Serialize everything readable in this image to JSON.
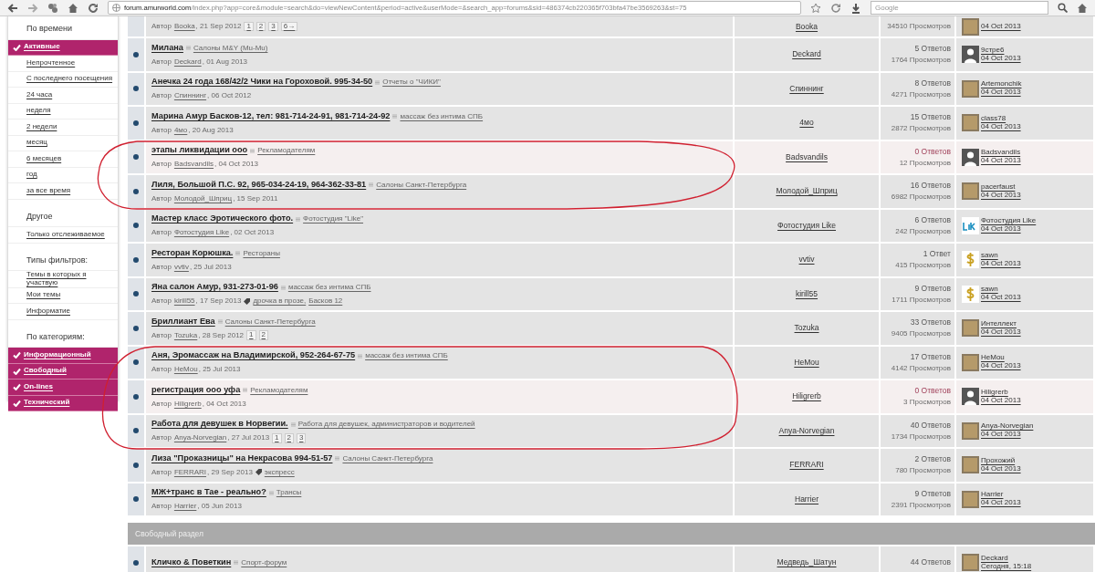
{
  "browser": {
    "url": "forum.amurworld.com/index.php?app=core&module=search&do=viewNewContent&period=active&userMode=&search_app=forums&sid=486374cb220365f703bfa47be3569263&st=75",
    "search_placeholder": "Google"
  },
  "sidebar": [
    {
      "heading": "По времени",
      "items": [
        {
          "label": "Активные",
          "selected": true
        },
        {
          "label": "Непрочтенное",
          "selected": false
        },
        {
          "label": "С последнего посещения",
          "selected": false
        },
        {
          "label": "24 часа",
          "selected": false
        },
        {
          "label": "неделя",
          "selected": false
        },
        {
          "label": "2 недели",
          "selected": false
        },
        {
          "label": "месяц",
          "selected": false
        },
        {
          "label": "6 месяцев",
          "selected": false
        },
        {
          "label": "год",
          "selected": false
        },
        {
          "label": "за все время",
          "selected": false
        }
      ]
    },
    {
      "heading": "Другое",
      "items": [
        {
          "label": "Только отслеживаемое",
          "selected": false
        }
      ]
    },
    {
      "heading": "Типы фильтров:",
      "items": [
        {
          "label": "Темы в которых я участвую",
          "selected": false
        },
        {
          "label": "Мои темы",
          "selected": false
        },
        {
          "label": "Информатие",
          "selected": false
        }
      ]
    },
    {
      "heading": "По категориям:",
      "items": [
        {
          "label": "Информационный",
          "selected": true
        },
        {
          "label": "Свободный",
          "selected": true
        },
        {
          "label": "On-lines",
          "selected": true
        },
        {
          "label": "Технический",
          "selected": true
        }
      ]
    }
  ],
  "topics": [
    {
      "by": "Автор",
      "author": "Booka",
      "date": ", 21 Sep 2012",
      "pages": [
        "1",
        "2",
        "3",
        "6→"
      ],
      "starter": "Booka",
      "views": "34510 Просмотров",
      "last_date": "04 Oct 2013",
      "avatar": {
        "kind": "photo"
      },
      "highlighted": false
    },
    {
      "title": "Милана",
      "forum": "Салоны M&Y (Mu-Mu)",
      "by": "Автор",
      "author": "Deckard",
      "date": ", 01 Aug 2013",
      "starter": "Deckard",
      "replies": "5 Ответов",
      "views": "1764 Просмотров",
      "last_poster": "9стре6",
      "last_date": "04 Oct 2013",
      "avatar": {
        "kind": "silhouette"
      },
      "highlighted": false
    },
    {
      "title": "Анечка 24 года 168/42/2 Чики на Гороховой. 995-34-50",
      "forum": "Отчеты о \"ЧИКИ\"",
      "by": "Автор",
      "author": "Спиннинг",
      "date": ", 06 Oct 2012",
      "starter": "Спиннинг",
      "replies": "8 Ответов",
      "views": "4271 Просмотров",
      "last_poster": "Artemonchik",
      "last_date": "04 Oct 2013",
      "avatar": {
        "kind": "photo"
      },
      "highlighted": false
    },
    {
      "title": "Марина Амур Басков-12, тел: 981-714-24-91, 981-714-24-92",
      "forum": "массаж без интима СПБ",
      "by": "Автор",
      "author": "4мо",
      "date": ", 20 Aug 2013",
      "starter": "4мо",
      "replies": "15 Ответов",
      "views": "2872 Просмотров",
      "last_poster": "class78",
      "last_date": "04 Oct 2013",
      "avatar": {
        "kind": "photo"
      },
      "highlighted": false
    },
    {
      "title": "этапы ликвидации ооо",
      "forum": "Рекламодателям",
      "by": "Автор",
      "author": "Badsvandils",
      "date": ", 04 Oct 2013",
      "starter": "Badsvandils",
      "replies": "0 Ответов",
      "views": "12 Просмотров",
      "last_poster": "Badsvandils",
      "last_date": "04 Oct 2013",
      "avatar": {
        "kind": "silhouette"
      },
      "highlighted": true
    },
    {
      "title": "Лиля, Большой П.С. 92, 965-034-24-19, 964-362-33-81",
      "forum": "Салоны Санкт-Петербурга",
      "by": "Автор",
      "author": "Молодой_Шприц",
      "date": ", 15 Sep 2011",
      "starter": "Молодой_Шприц",
      "replies": "16 Ответов",
      "views": "6982 Просмотров",
      "last_poster": "pacerfaust",
      "last_date": "04 Oct 2013",
      "avatar": {
        "kind": "photo"
      },
      "highlighted": false
    },
    {
      "title": "Мастер класс Эротического фото.",
      "forum": "Фотостудия \"Like\"",
      "by": "Автор",
      "author": "Фотостудия Like",
      "date": ", 02 Oct 2013",
      "starter": "Фотостудия Like",
      "replies": "6 Ответов",
      "views": "242 Просмотров",
      "last_poster": "Фотостудия Like",
      "last_date": "04 Oct 2013",
      "avatar": {
        "kind": "logo"
      },
      "highlighted": false
    },
    {
      "title": "Ресторан Корюшка.",
      "forum": "Рестораны",
      "by": "Автор",
      "author": "vvtiv",
      "date": ", 25 Jul 2013",
      "starter": "vvtiv",
      "replies": "1 Ответ",
      "views": "415 Просмотров",
      "last_poster": "sawn",
      "last_date": "04 Oct 2013",
      "avatar": {
        "kind": "dollar"
      },
      "highlighted": false
    },
    {
      "title": "Яна салон Амур, 931-273-01-96",
      "forum": "массаж без интима СПБ",
      "by": "Автор",
      "author": "kirill55",
      "date": ", 17 Sep 2013",
      "tags": [
        "дрочка в прозе,",
        "Басков 12"
      ],
      "starter": "kirill55",
      "replies": "9 Ответов",
      "views": "1711 Просмотров",
      "last_poster": "sawn",
      "last_date": "04 Oct 2013",
      "avatar": {
        "kind": "dollar"
      },
      "highlighted": false
    },
    {
      "title": "Бриллиант Ева",
      "forum": "Салоны Санкт-Петербурга",
      "by": "Автор",
      "author": "Tozuka",
      "date": ", 28 Sep 2012",
      "pages": [
        "1",
        "2"
      ],
      "starter": "Tozuka",
      "replies": "33 Ответов",
      "views": "9405 Просмотров",
      "last_poster": "Интеллект",
      "last_date": "04 Oct 2013",
      "avatar": {
        "kind": "photo"
      },
      "highlighted": false
    },
    {
      "title": "Аня, Эромассаж на Владимирской, 952-264-67-75",
      "forum": "массаж без интима СПБ",
      "by": "Автор",
      "author": "HeMou",
      "date": ", 25 Jul 2013",
      "starter": "HeMou",
      "replies": "17 Ответов",
      "views": "4142 Просмотров",
      "last_poster": "HeMou",
      "last_date": "04 Oct 2013",
      "avatar": {
        "kind": "photo"
      },
      "highlighted": false
    },
    {
      "title": "регистрация ооо уфа",
      "forum": "Рекламодателям",
      "by": "Автор",
      "author": "Hiligrerb",
      "date": ", 04 Oct 2013",
      "starter": "Hiligrerb",
      "replies": "0 Ответов",
      "views": "3 Просмотров",
      "last_poster": "Hiligrerb",
      "last_date": "04 Oct 2013",
      "avatar": {
        "kind": "silhouette"
      },
      "highlighted": true
    },
    {
      "title": "Работа для девушек в Норвегии.",
      "forum": "Работа для девушек, администраторов и водителей",
      "by": "Автор",
      "author": "Anya-Norvegian",
      "date": ", 27 Jul 2013",
      "pages": [
        "1",
        "2",
        "3"
      ],
      "starter": "Anya-Norvegian",
      "replies": "40 Ответов",
      "views": "1734 Просмотров",
      "last_poster": "Anya-Norvegian",
      "last_date": "04 Oct 2013",
      "avatar": {
        "kind": "photo"
      },
      "highlighted": false
    },
    {
      "title": "Лиза \"Проказницы\" на Некрасова 994-51-57",
      "forum": "Салоны Санкт-Петербурга",
      "by": "Автор",
      "author": "FERRARI",
      "date": ", 29 Sep 2013",
      "tags": [
        "экспресс"
      ],
      "starter": "FERRARI",
      "replies": "2 Ответов",
      "views": "780 Просмотров",
      "last_poster": "Прохожий",
      "last_date": "04 Oct 2013",
      "avatar": {
        "kind": "photo"
      },
      "highlighted": false
    },
    {
      "title": "МЖ+транс в Тае - реально?",
      "forum": "Трансы",
      "by": "Автор",
      "author": "Harrier",
      "date": ", 05 Jun 2013",
      "starter": "Harrier",
      "replies": "9 Ответов",
      "views": "2391 Просмотров",
      "last_poster": "Harrier",
      "last_date": "04 Oct 2013",
      "avatar": {
        "kind": "photo"
      },
      "highlighted": false
    }
  ],
  "section": {
    "title": "Свободный раздел",
    "topics": [
      {
        "title": "Кличко & Поветкин",
        "forum": "Спорт-форум",
        "starter": "Медведь_Шатун",
        "replies": "44 Ответов",
        "last_poster": "Deckard",
        "last_date": "Сегодня, 15:18",
        "avatar": {
          "kind": "photo"
        },
        "highlighted": false
      }
    ]
  }
}
